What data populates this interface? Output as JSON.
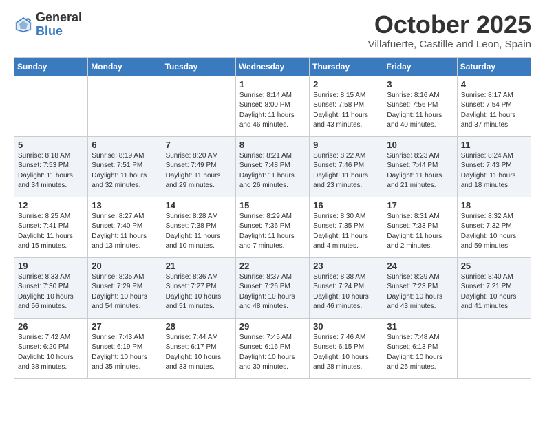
{
  "logo": {
    "general": "General",
    "blue": "Blue"
  },
  "header": {
    "month": "October 2025",
    "location": "Villafuerte, Castille and Leon, Spain"
  },
  "days_of_week": [
    "Sunday",
    "Monday",
    "Tuesday",
    "Wednesday",
    "Thursday",
    "Friday",
    "Saturday"
  ],
  "weeks": [
    [
      {
        "day": "",
        "info": ""
      },
      {
        "day": "",
        "info": ""
      },
      {
        "day": "",
        "info": ""
      },
      {
        "day": "1",
        "info": "Sunrise: 8:14 AM\nSunset: 8:00 PM\nDaylight: 11 hours\nand 46 minutes."
      },
      {
        "day": "2",
        "info": "Sunrise: 8:15 AM\nSunset: 7:58 PM\nDaylight: 11 hours\nand 43 minutes."
      },
      {
        "day": "3",
        "info": "Sunrise: 8:16 AM\nSunset: 7:56 PM\nDaylight: 11 hours\nand 40 minutes."
      },
      {
        "day": "4",
        "info": "Sunrise: 8:17 AM\nSunset: 7:54 PM\nDaylight: 11 hours\nand 37 minutes."
      }
    ],
    [
      {
        "day": "5",
        "info": "Sunrise: 8:18 AM\nSunset: 7:53 PM\nDaylight: 11 hours\nand 34 minutes."
      },
      {
        "day": "6",
        "info": "Sunrise: 8:19 AM\nSunset: 7:51 PM\nDaylight: 11 hours\nand 32 minutes."
      },
      {
        "day": "7",
        "info": "Sunrise: 8:20 AM\nSunset: 7:49 PM\nDaylight: 11 hours\nand 29 minutes."
      },
      {
        "day": "8",
        "info": "Sunrise: 8:21 AM\nSunset: 7:48 PM\nDaylight: 11 hours\nand 26 minutes."
      },
      {
        "day": "9",
        "info": "Sunrise: 8:22 AM\nSunset: 7:46 PM\nDaylight: 11 hours\nand 23 minutes."
      },
      {
        "day": "10",
        "info": "Sunrise: 8:23 AM\nSunset: 7:44 PM\nDaylight: 11 hours\nand 21 minutes."
      },
      {
        "day": "11",
        "info": "Sunrise: 8:24 AM\nSunset: 7:43 PM\nDaylight: 11 hours\nand 18 minutes."
      }
    ],
    [
      {
        "day": "12",
        "info": "Sunrise: 8:25 AM\nSunset: 7:41 PM\nDaylight: 11 hours\nand 15 minutes."
      },
      {
        "day": "13",
        "info": "Sunrise: 8:27 AM\nSunset: 7:40 PM\nDaylight: 11 hours\nand 13 minutes."
      },
      {
        "day": "14",
        "info": "Sunrise: 8:28 AM\nSunset: 7:38 PM\nDaylight: 11 hours\nand 10 minutes."
      },
      {
        "day": "15",
        "info": "Sunrise: 8:29 AM\nSunset: 7:36 PM\nDaylight: 11 hours\nand 7 minutes."
      },
      {
        "day": "16",
        "info": "Sunrise: 8:30 AM\nSunset: 7:35 PM\nDaylight: 11 hours\nand 4 minutes."
      },
      {
        "day": "17",
        "info": "Sunrise: 8:31 AM\nSunset: 7:33 PM\nDaylight: 11 hours\nand 2 minutes."
      },
      {
        "day": "18",
        "info": "Sunrise: 8:32 AM\nSunset: 7:32 PM\nDaylight: 10 hours\nand 59 minutes."
      }
    ],
    [
      {
        "day": "19",
        "info": "Sunrise: 8:33 AM\nSunset: 7:30 PM\nDaylight: 10 hours\nand 56 minutes."
      },
      {
        "day": "20",
        "info": "Sunrise: 8:35 AM\nSunset: 7:29 PM\nDaylight: 10 hours\nand 54 minutes."
      },
      {
        "day": "21",
        "info": "Sunrise: 8:36 AM\nSunset: 7:27 PM\nDaylight: 10 hours\nand 51 minutes."
      },
      {
        "day": "22",
        "info": "Sunrise: 8:37 AM\nSunset: 7:26 PM\nDaylight: 10 hours\nand 48 minutes."
      },
      {
        "day": "23",
        "info": "Sunrise: 8:38 AM\nSunset: 7:24 PM\nDaylight: 10 hours\nand 46 minutes."
      },
      {
        "day": "24",
        "info": "Sunrise: 8:39 AM\nSunset: 7:23 PM\nDaylight: 10 hours\nand 43 minutes."
      },
      {
        "day": "25",
        "info": "Sunrise: 8:40 AM\nSunset: 7:21 PM\nDaylight: 10 hours\nand 41 minutes."
      }
    ],
    [
      {
        "day": "26",
        "info": "Sunrise: 7:42 AM\nSunset: 6:20 PM\nDaylight: 10 hours\nand 38 minutes."
      },
      {
        "day": "27",
        "info": "Sunrise: 7:43 AM\nSunset: 6:19 PM\nDaylight: 10 hours\nand 35 minutes."
      },
      {
        "day": "28",
        "info": "Sunrise: 7:44 AM\nSunset: 6:17 PM\nDaylight: 10 hours\nand 33 minutes."
      },
      {
        "day": "29",
        "info": "Sunrise: 7:45 AM\nSunset: 6:16 PM\nDaylight: 10 hours\nand 30 minutes."
      },
      {
        "day": "30",
        "info": "Sunrise: 7:46 AM\nSunset: 6:15 PM\nDaylight: 10 hours\nand 28 minutes."
      },
      {
        "day": "31",
        "info": "Sunrise: 7:48 AM\nSunset: 6:13 PM\nDaylight: 10 hours\nand 25 minutes."
      },
      {
        "day": "",
        "info": ""
      }
    ]
  ]
}
